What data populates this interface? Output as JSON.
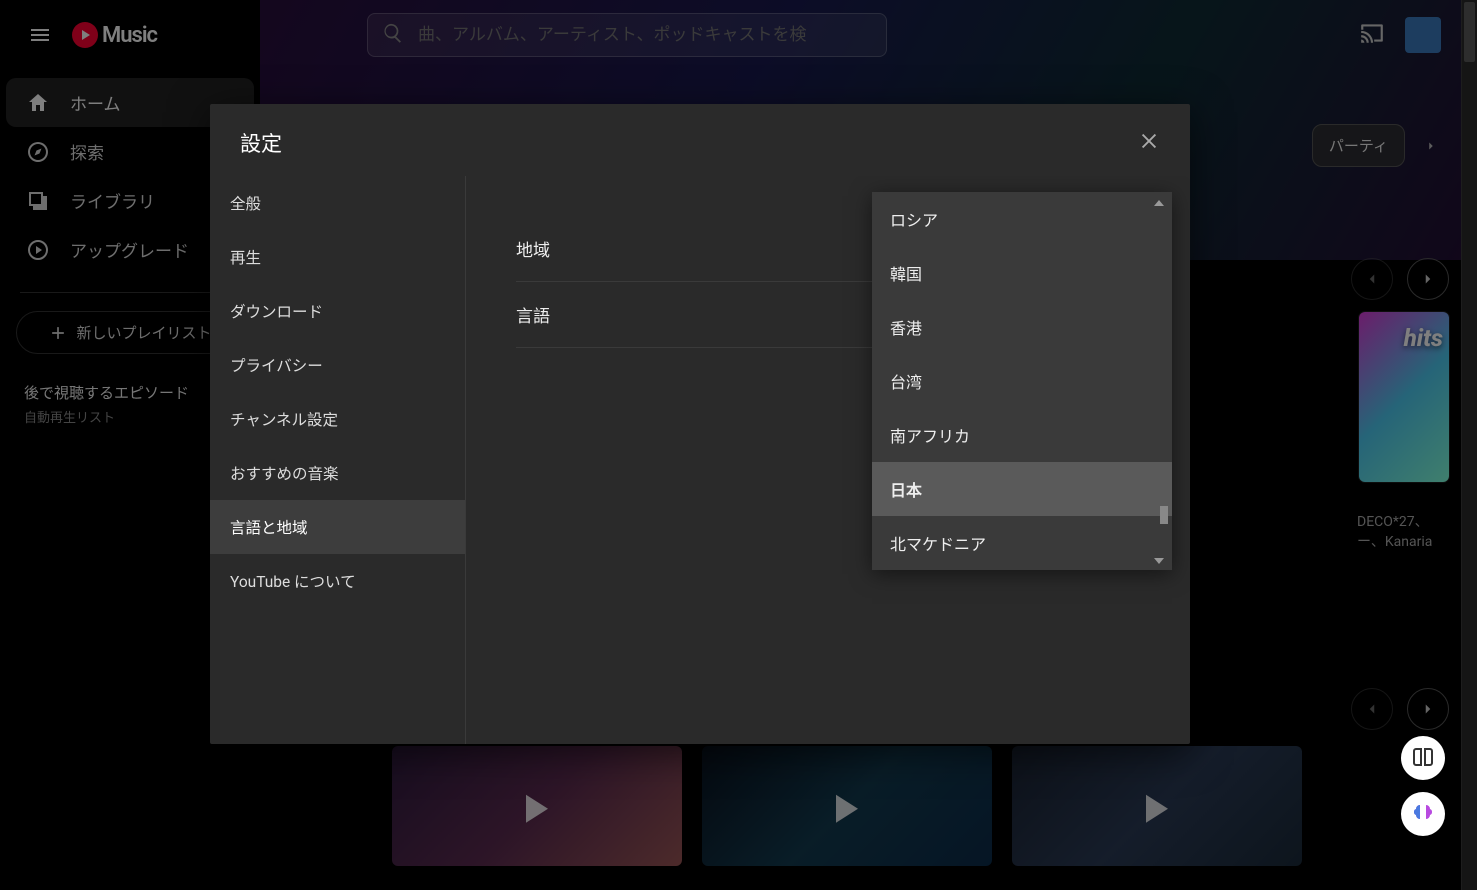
{
  "header": {
    "logo_text": "Music",
    "search_placeholder": "曲、アルバム、アーティスト、ポッドキャストを検"
  },
  "sidebar": {
    "items": [
      {
        "label": "ホーム"
      },
      {
        "label": "探索"
      },
      {
        "label": "ライブラリ"
      },
      {
        "label": "アップグレード"
      }
    ],
    "new_playlist_label": "新しいプレイリスト",
    "section": {
      "title": "後で視聴するエピソード",
      "subtitle": "自動再生リスト"
    }
  },
  "chips": {
    "party_label": "パーティ"
  },
  "modal": {
    "title": "設定",
    "tabs": [
      {
        "label": "全般"
      },
      {
        "label": "再生"
      },
      {
        "label": "ダウンロード"
      },
      {
        "label": "プライバシー"
      },
      {
        "label": "チャンネル設定"
      },
      {
        "label": "おすすめの音楽"
      },
      {
        "label": "言語と地域"
      },
      {
        "label": "YouTube について"
      }
    ],
    "active_tab_index": 6,
    "settings": {
      "region_label": "地域",
      "language_label": "言語"
    },
    "region_options": [
      "ロシア",
      "韓国",
      "香港",
      "台湾",
      "南アフリカ",
      "日本",
      "北マケドニア"
    ],
    "region_selected": "日本"
  },
  "card": {
    "thumb_text": "hits",
    "meta_line1": "DECO*27、",
    "meta_line2": "ー、Kanaria"
  }
}
